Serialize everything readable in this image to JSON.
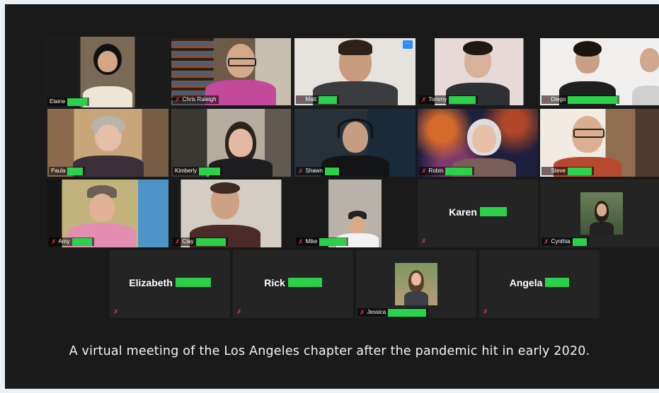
{
  "participants": [
    {
      "name": "Elaine",
      "muted": false
    },
    {
      "name": "Chris Raleigh",
      "muted": true
    },
    {
      "name": "Matt",
      "muted": true
    },
    {
      "name": "Tommy",
      "muted": true
    },
    {
      "name": "Diego",
      "muted": true
    },
    {
      "name": "Paula",
      "muted": false
    },
    {
      "name": "Kimberly",
      "muted": false
    },
    {
      "name": "Shawn",
      "muted": true
    },
    {
      "name": "Robin",
      "muted": true
    },
    {
      "name": "Steve",
      "muted": true
    },
    {
      "name": "Amy",
      "muted": true
    },
    {
      "name": "Clay",
      "muted": true
    },
    {
      "name": "Mike",
      "muted": true
    },
    {
      "name": "Karen",
      "muted": true
    },
    {
      "name": "Cynthia",
      "muted": true
    },
    {
      "name": "Elizabeth",
      "muted": true
    },
    {
      "name": "Rick",
      "muted": true
    },
    {
      "name": "Jessica",
      "muted": true
    },
    {
      "name": "Angela",
      "muted": true
    }
  ],
  "more_button": "···",
  "caption": "A virtual meeting of the Los Angeles chapter after the pandemic hit in early 2020.",
  "colors": {
    "active_border": "#d9e36b",
    "redaction": "#2bd14a",
    "muted_mic": "#e0393e"
  }
}
